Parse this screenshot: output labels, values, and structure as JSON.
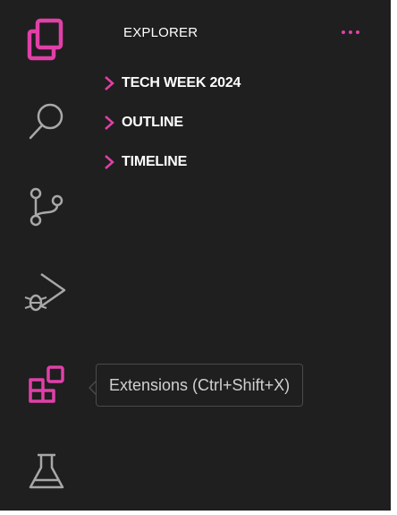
{
  "colors": {
    "accent": "#e040a8",
    "icon_inactive": "#a8a8a8",
    "background": "#1f1f1f",
    "text": "#ffffff",
    "tooltip_text": "#d0d0d0"
  },
  "activity_bar": {
    "items": [
      {
        "icon": "explorer-files-icon",
        "active": true
      },
      {
        "icon": "search-icon",
        "active": false
      },
      {
        "icon": "source-control-icon",
        "active": false
      },
      {
        "icon": "run-debug-icon",
        "active": false
      },
      {
        "icon": "extensions-icon",
        "active": false,
        "highlighted": true
      },
      {
        "icon": "testing-flask-icon",
        "active": false
      }
    ]
  },
  "sidebar": {
    "title": "EXPLORER",
    "more_icon": "ellipsis-icon",
    "sections": [
      {
        "label": "TECH WEEK 2024"
      },
      {
        "label": "OUTLINE"
      },
      {
        "label": "TIMELINE"
      }
    ]
  },
  "tooltip": {
    "text": "Extensions (Ctrl+Shift+X)"
  }
}
